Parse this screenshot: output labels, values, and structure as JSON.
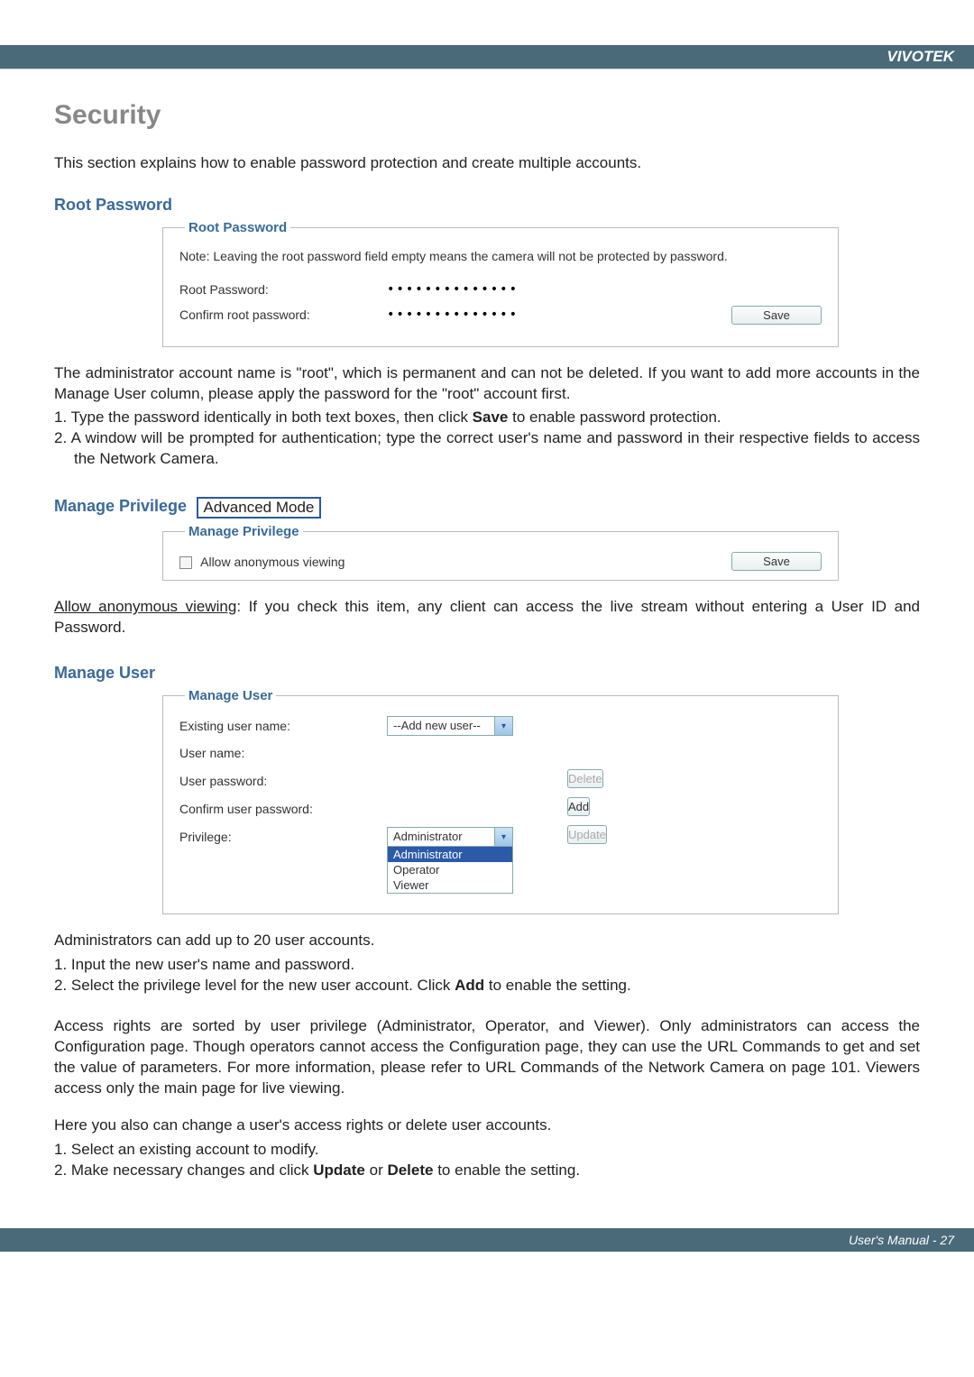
{
  "brand": "VIVOTEK",
  "footer": {
    "text": "User's Manual - 27"
  },
  "security": {
    "title": "Security",
    "intro": "This section explains how to enable password protection and create multiple accounts."
  },
  "root_password": {
    "heading": "Root Password",
    "legend": "Root Password",
    "note": "Note: Leaving the root password field empty means the camera will not be protected by password.",
    "row1_label": "Root Password:",
    "row1_value": "••••••••••••••",
    "row2_label": "Confirm root password:",
    "row2_value": "••••••••••••••",
    "save_label": "Save"
  },
  "root_explain": {
    "p1": "The administrator account name is \"root\", which is permanent and can not be deleted. If you want to add more accounts in the Manage User column, please apply the password for the \"root\" account first.",
    "l1_pre": "1. Type the password identically in both text boxes, then click ",
    "l1_bold": "Save",
    "l1_post": " to enable password protection.",
    "l2": "2. A window will be prompted for authentication; type the correct user's name and password in their respective fields to access the Network Camera."
  },
  "manage_privilege": {
    "heading": "Manage Privilege",
    "adv_mode": "Advanced Mode",
    "legend": "Manage Privilege",
    "checkbox_label": "Allow anonymous viewing",
    "save_label": "Save",
    "desc_uline": "Allow anonymous viewing",
    "desc_rest": ": If you check this item, any client can access the live stream without entering a User ID and Password."
  },
  "manage_user": {
    "heading": "Manage User",
    "legend": "Manage User",
    "existing_label": "Existing user name:",
    "existing_value": "--Add new user--",
    "username_label": "User name:",
    "userpw_label": "User password:",
    "confirmpw_label": "Confirm user password:",
    "privilege_label": "Privilege:",
    "privilege_value": "Administrator",
    "options": [
      "Administrator",
      "Operator",
      "Viewer"
    ],
    "delete_label": "Delete",
    "add_label": "Add",
    "update_label": "Update"
  },
  "admin_explain": {
    "p1": "Administrators can add up to 20 user accounts.",
    "l1": "1. Input the new user's name and password.",
    "l2_pre": "2. Select the privilege level for the new user account. Click ",
    "l2_bold": "Add",
    "l2_post": " to enable the setting.",
    "p2": "Access rights are sorted by user privilege (Administrator, Operator, and Viewer). Only administrators can access the Configuration page. Though operators cannot access the Configuration page, they can use the URL Commands to get and set the value of parameters. For more information, please refer to URL Commands of the Network Camera on page 101. Viewers access only the main page for live viewing.",
    "p3": "Here you also can change a user's access rights or delete user accounts.",
    "l3": "1. Select an existing account to modify.",
    "l4_pre": "2. Make necessary changes and click ",
    "l4_b1": "Update",
    "l4_mid": " or ",
    "l4_b2": "Delete",
    "l4_post": " to enable the setting."
  }
}
